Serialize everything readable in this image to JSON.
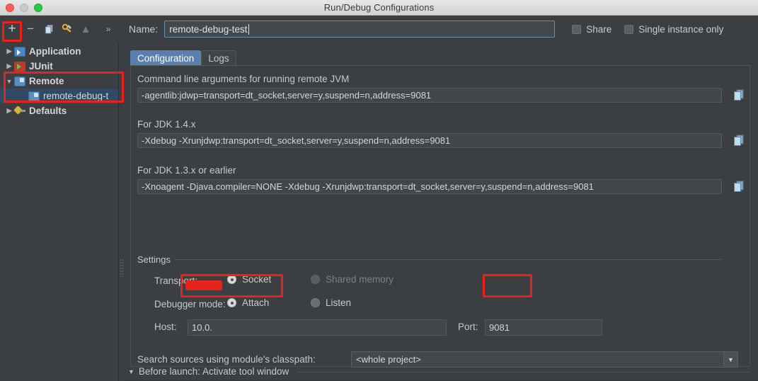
{
  "window": {
    "title": "Run/Debug Configurations",
    "traffic_lights": [
      "close",
      "minimize",
      "zoom"
    ]
  },
  "toolbar": {
    "buttons": [
      {
        "name": "add-configuration-button",
        "icon": "plus-icon",
        "glyph": "+"
      },
      {
        "name": "remove-configuration-button",
        "icon": "minus-icon",
        "glyph": "−"
      },
      {
        "name": "copy-configuration-button",
        "icon": "copy-icon",
        "glyph": ""
      },
      {
        "name": "edit-templates-button",
        "icon": "wrench-icon",
        "glyph": ""
      },
      {
        "name": "move-up-button",
        "icon": "arrow-up-icon",
        "glyph": "▲"
      },
      {
        "name": "more-button",
        "icon": "chevron-double-right-icon",
        "glyph": "»"
      }
    ],
    "name_label": "Name:",
    "name_value": "remote-debug-test",
    "share_label": "Share",
    "share_checked": false,
    "single_instance_label": "Single instance only",
    "single_instance_checked": false
  },
  "sidebar": {
    "items": [
      {
        "label": "Application",
        "icon": "application-icon",
        "expanded": false,
        "level": 0,
        "selected": false
      },
      {
        "label": "JUnit",
        "icon": "junit-icon",
        "expanded": false,
        "level": 0,
        "selected": false
      },
      {
        "label": "Remote",
        "icon": "remote-icon",
        "expanded": true,
        "level": 0,
        "selected": false
      },
      {
        "label": "remote-debug-t",
        "icon": "remote-icon",
        "expanded": null,
        "level": 1,
        "selected": true
      },
      {
        "label": "Defaults",
        "icon": "defaults-icon",
        "expanded": false,
        "level": 0,
        "selected": false
      }
    ]
  },
  "tabs": [
    {
      "label": "Configuration",
      "active": true
    },
    {
      "label": "Logs",
      "active": false
    }
  ],
  "form": {
    "cmdline_label": "Command line arguments for running remote JVM",
    "cmdline_value": "-agentlib:jdwp=transport=dt_socket,server=y,suspend=n,address=9081",
    "jdk14_label": "For JDK 1.4.x",
    "jdk14_value": "-Xdebug -Xrunjdwp:transport=dt_socket,server=y,suspend=n,address=9081",
    "jdk13_label": "For JDK 1.3.x or earlier",
    "jdk13_value": "-Xnoagent -Djava.compiler=NONE -Xdebug -Xrunjdwp:transport=dt_socket,server=y,suspend=n,address=9081",
    "copy_button_label": "copy-icon",
    "settings_group_label": "Settings",
    "transport_label": "Transport:",
    "transport_options": [
      {
        "label": "Socket",
        "selected": true,
        "disabled": false
      },
      {
        "label": "Shared memory",
        "selected": false,
        "disabled": true
      }
    ],
    "debugger_mode_label": "Debugger mode:",
    "debugger_mode_options": [
      {
        "label": "Attach",
        "selected": true,
        "disabled": false
      },
      {
        "label": "Listen",
        "selected": false,
        "disabled": false
      }
    ],
    "host_label": "Host:",
    "host_value": "10.0.",
    "port_label": "Port:",
    "port_value": "9081",
    "search_sources_label": "Search sources using module's classpath:",
    "search_sources_value": "<whole project>",
    "before_launch_label": "Before launch: Activate tool window",
    "before_launch_expanded": true
  },
  "annotations": {
    "color": "#e8241a",
    "boxes": [
      "add-button-highlight",
      "remote-tree-highlight",
      "host-field-highlight",
      "port-field-highlight"
    ]
  }
}
